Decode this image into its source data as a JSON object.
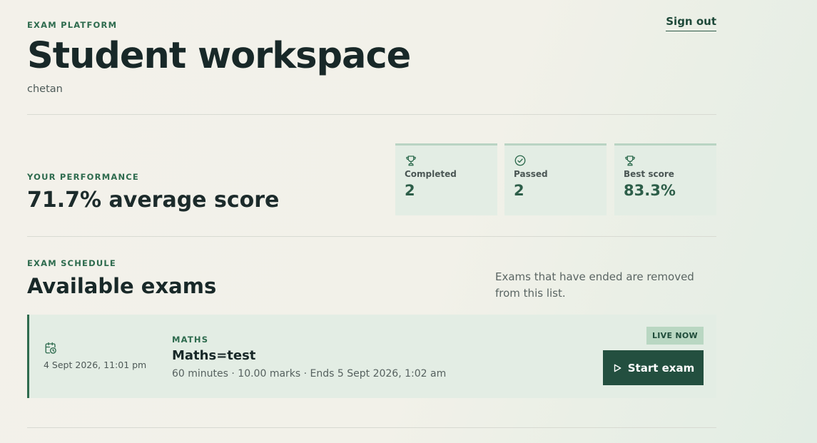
{
  "header": {
    "eyebrow": "EXAM PLATFORM",
    "title": "Student workspace",
    "username": "chetan",
    "signout_label": "Sign out"
  },
  "performance": {
    "eyebrow": "YOUR PERFORMANCE",
    "summary": "71.7% average score",
    "stats": [
      {
        "icon": "trophy-icon",
        "label": "Completed",
        "value": "2"
      },
      {
        "icon": "check-circle-icon",
        "label": "Passed",
        "value": "2"
      },
      {
        "icon": "trophy-icon",
        "label": "Best score",
        "value": "83.3%"
      }
    ]
  },
  "schedule": {
    "eyebrow": "EXAM SCHEDULE",
    "title": "Available exams",
    "note": "Exams that have ended are removed from this list.",
    "exams": [
      {
        "icon": "calendar-clock-icon",
        "date": "4 Sept 2026, 11:01 pm",
        "subject": "MATHS",
        "title": "Maths=test",
        "meta": "60 minutes · 10.00 marks · Ends 5 Sept 2026, 1:02 am",
        "status": "LIVE NOW",
        "action_label": "Start exam"
      }
    ]
  },
  "colors": {
    "accent": "#2e6b4e",
    "button": "#234f3f",
    "card": "#e3ede4",
    "badge": "#b9d7c2"
  }
}
